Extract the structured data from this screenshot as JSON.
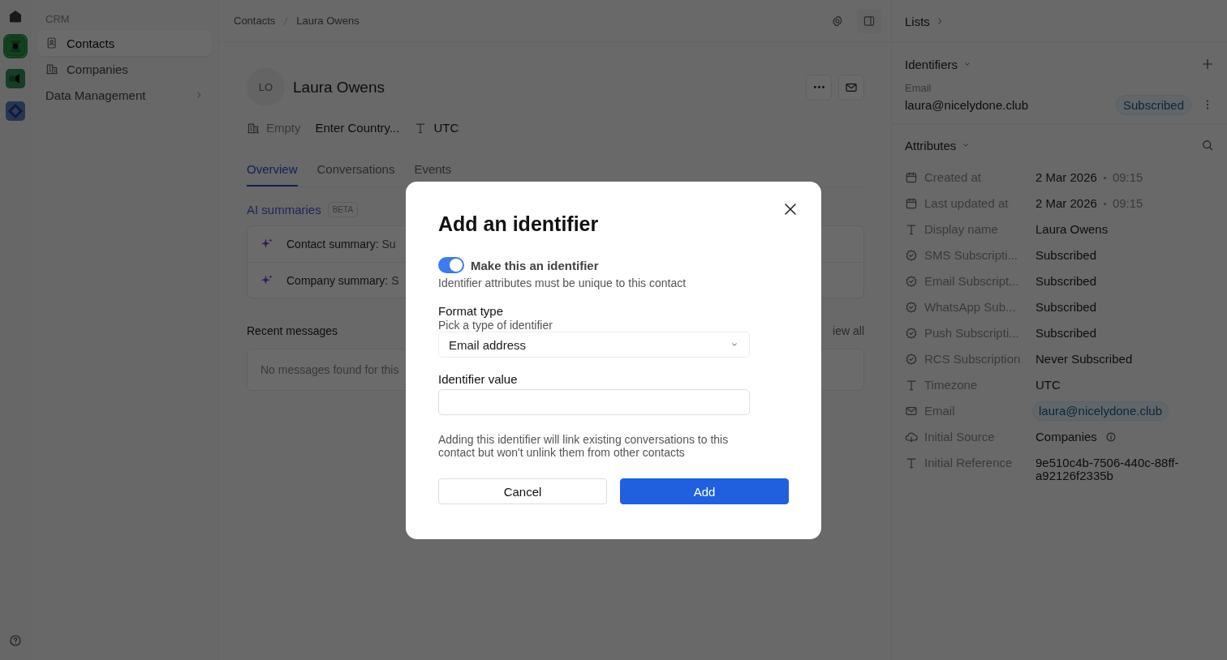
{
  "rail": {
    "apps": [
      {
        "kind": "home"
      },
      {
        "kind": "contacts",
        "selected": true
      },
      {
        "kind": "video",
        "selected": false
      },
      {
        "kind": "diamond",
        "selected": false
      }
    ]
  },
  "sidebar": {
    "section": "CRM",
    "items": [
      {
        "label": "Contacts",
        "kind": "contact",
        "selected": true
      },
      {
        "label": "Companies",
        "kind": "building",
        "selected": false
      },
      {
        "label": "Data Management",
        "kind": "group",
        "selected": false
      }
    ]
  },
  "breadcrumb": [
    "Contacts",
    "Laura Owens"
  ],
  "contact": {
    "initials": "LO",
    "name": "Laura Owens",
    "meta": [
      {
        "kind": "company",
        "text": "Empty"
      },
      {
        "kind": "country",
        "text": "Enter Country..."
      },
      {
        "kind": "timezone",
        "text": "UTC"
      }
    ]
  },
  "tabs": [
    {
      "label": "Overview",
      "selected": true
    },
    {
      "label": "Conversations",
      "selected": false
    },
    {
      "label": "Events",
      "selected": false
    }
  ],
  "ai_summaries": {
    "title": "AI summaries",
    "badge": "BETA",
    "rows": [
      "**Contact summary:** Su",
      "**Company summary:** S"
    ]
  },
  "recent_messages": {
    "title": "Recent messages",
    "link": "iew all",
    "empty": "No messages found for this"
  },
  "right_panel": {
    "lists": "Lists",
    "identifiers": {
      "title": "Identifiers",
      "items": [
        {
          "label": "Email",
          "value": "laura@nicelydone.club",
          "status": "Subscribed"
        }
      ]
    },
    "attributes": {
      "title": "Attributes",
      "rows": [
        {
          "kind": "date",
          "label": "Created at",
          "value": "2 Mar 2026",
          "time": "09:15"
        },
        {
          "kind": "date",
          "label": "Last updated at",
          "value": "2 Mar 2026",
          "time": "09:15"
        },
        {
          "kind": "text",
          "label": "Display name",
          "value": "Laura Owens"
        },
        {
          "kind": "subscription",
          "label": "SMS Subscripti...",
          "value": "Subscribed"
        },
        {
          "kind": "subscription",
          "label": "Email Subscript...",
          "value": "Subscribed"
        },
        {
          "kind": "subscription",
          "label": "WhatsApp Sub...",
          "value": "Subscribed"
        },
        {
          "kind": "subscription",
          "label": "Push Subscripti...",
          "value": "Subscribed"
        },
        {
          "kind": "subscription",
          "label": "RCS Subscription",
          "value": "Never Subscribed"
        },
        {
          "kind": "text",
          "label": "Timezone",
          "value": "UTC"
        },
        {
          "kind": "email",
          "label": "Email",
          "value": "laura@nicelydone.club"
        },
        {
          "kind": "source",
          "label": "Initial Source",
          "value": "Companies"
        },
        {
          "kind": "text",
          "label": "Initial Reference",
          "value": "9e510c4b-7506-440c-88ff-a92126f2335b"
        }
      ]
    }
  },
  "modal": {
    "title": "Add an identifier",
    "toggle": {
      "label": "Make this an identifier",
      "on": true,
      "description": "Identifier attributes must be unique to this contact"
    },
    "format": {
      "label": "Format type",
      "hint": "Pick a type of identifier",
      "value": "Email address"
    },
    "value_field": {
      "label": "Identifier value"
    },
    "note": "Adding this identifier will link existing conversations to this contact but won't unlink them from other contacts",
    "buttons": [
      {
        "label": "Cancel",
        "kind": "secondary"
      },
      {
        "label": "Add",
        "kind": "primary"
      }
    ]
  }
}
